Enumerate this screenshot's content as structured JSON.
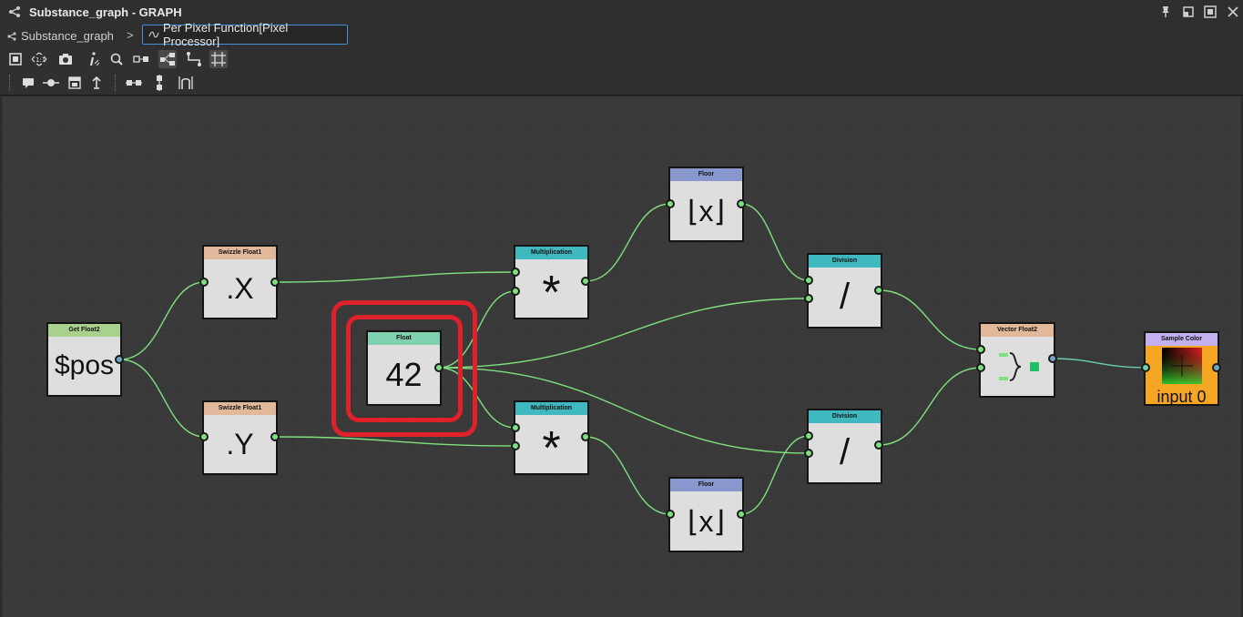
{
  "window": {
    "title": "Substance_graph - GRAPH"
  },
  "breadcrumb": {
    "root": "Substance_graph",
    "separator": ">",
    "current": "Per Pixel Function[Pixel Processor]"
  },
  "colors": {
    "wire": "#7ee07e",
    "highlight": "#e0202a",
    "header_getfloat": "#a9d18e",
    "header_swizzle": "#e1b89a",
    "header_float": "#7fd1b0",
    "header_mult": "#3fb8c0",
    "header_floor": "#8898cf",
    "header_division": "#3fb8c0",
    "header_vector": "#e1b89a",
    "header_sample": "#c3b0ef",
    "sample_body": "#f5a623"
  },
  "nodes": {
    "getfloat2": {
      "header": "Get Float2",
      "body": "$pos"
    },
    "swizzle_x": {
      "header": "Swizzle Float1",
      "body": ".X"
    },
    "swizzle_y": {
      "header": "Swizzle Float1",
      "body": ".Y"
    },
    "float": {
      "header": "Float",
      "body": "42"
    },
    "mult_top": {
      "header": "Multiplication",
      "body": "*"
    },
    "mult_bottom": {
      "header": "Multiplication",
      "body": "*"
    },
    "floor_top": {
      "header": "Floor",
      "body": "⌊x⌋"
    },
    "floor_bottom": {
      "header": "Floor",
      "body": "⌊x⌋"
    },
    "div_top": {
      "header": "Division",
      "body": "/"
    },
    "div_bottom": {
      "header": "Division",
      "body": "/"
    },
    "vector": {
      "header": "Vector Float2",
      "body": ""
    },
    "sample": {
      "header": "Sample Color",
      "body": "input 0"
    }
  },
  "toolbar_icons": [
    "frame-all-icon",
    "fit-1to1-icon",
    "camera-icon",
    "info-icon",
    "zoom-icon",
    "align-icon",
    "layout-icon",
    "connector-icon",
    "grid-snap-icon"
  ],
  "toolbar2_icons": [
    "comment-icon",
    "pin-icon",
    "frame-icon",
    "anchor-icon",
    "align-h-icon",
    "align-v-icon",
    "distribute-icon"
  ]
}
